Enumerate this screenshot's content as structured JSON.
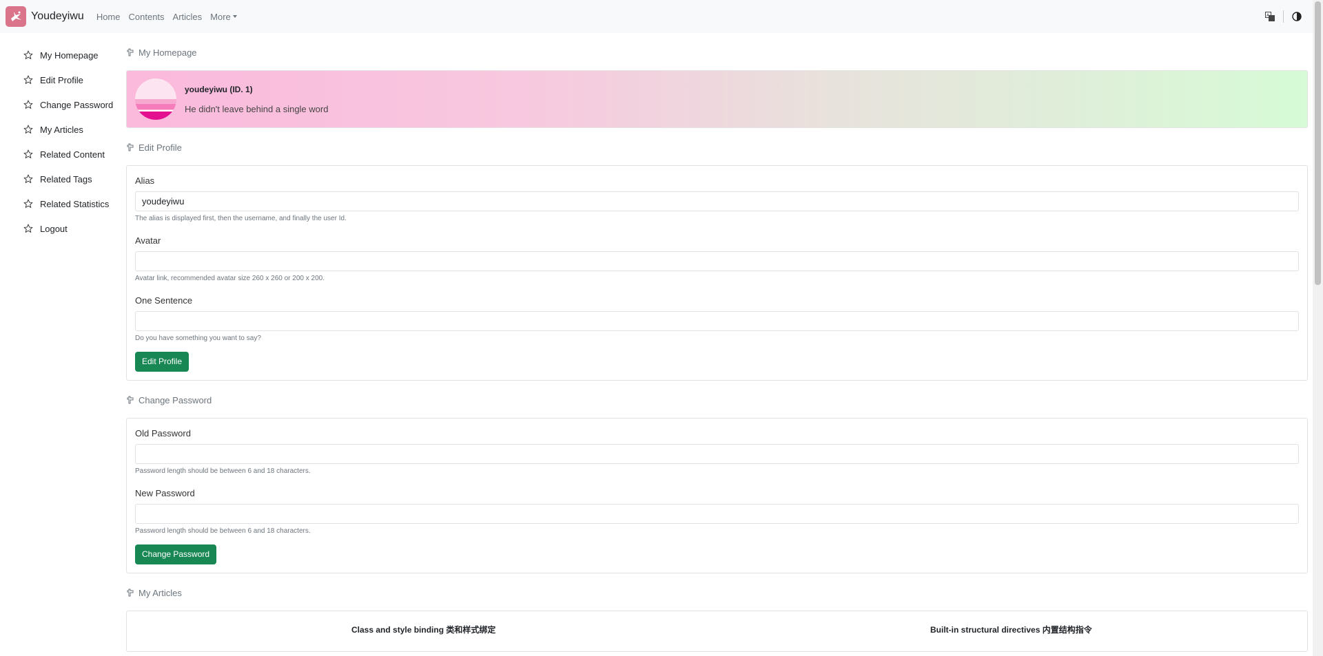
{
  "navbar": {
    "brand_name": "Youdeyiwu",
    "links": [
      "Home",
      "Contents",
      "Articles"
    ],
    "more_label": "More"
  },
  "icons": {
    "logo": "bird-logo-icon",
    "translate": "translate-icon",
    "theme": "contrast-icon",
    "star": "star-icon",
    "section": "hand-point-icon"
  },
  "colors": {
    "primary_green": "#198754",
    "logo_bg": "#d9748a",
    "banner_start": "#fbb9dc",
    "banner_end": "#d6fbd6"
  },
  "sidebar": {
    "items": [
      "My Homepage",
      "Edit Profile",
      "Change Password",
      "My Articles",
      "Related Content",
      "Related Tags",
      "Related Statistics",
      "Logout"
    ]
  },
  "homepage": {
    "title": "My Homepage",
    "username": "youdeyiwu (ID. 1)",
    "quote": "He didn't leave behind a single word"
  },
  "edit_profile": {
    "title": "Edit Profile",
    "alias_label": "Alias",
    "alias_value": "youdeyiwu",
    "alias_help": "The alias is displayed first, then the username, and finally the user Id.",
    "avatar_label": "Avatar",
    "avatar_value": "",
    "avatar_help": "Avatar link, recommended avatar size 260 x 260 or 200 x 200.",
    "sentence_label": "One Sentence",
    "sentence_value": "",
    "sentence_help": "Do you have something you want to say?",
    "submit_label": "Edit Profile"
  },
  "change_password": {
    "title": "Change Password",
    "old_label": "Old Password",
    "old_help": "Password length should be between 6 and 18 characters.",
    "new_label": "New Password",
    "new_help": "Password length should be between 6 and 18 characters.",
    "submit_label": "Change Password"
  },
  "my_articles": {
    "title": "My Articles",
    "articles": [
      "Class and style binding 类和样式绑定",
      "Built-in structural directives 内置结构指令"
    ]
  }
}
